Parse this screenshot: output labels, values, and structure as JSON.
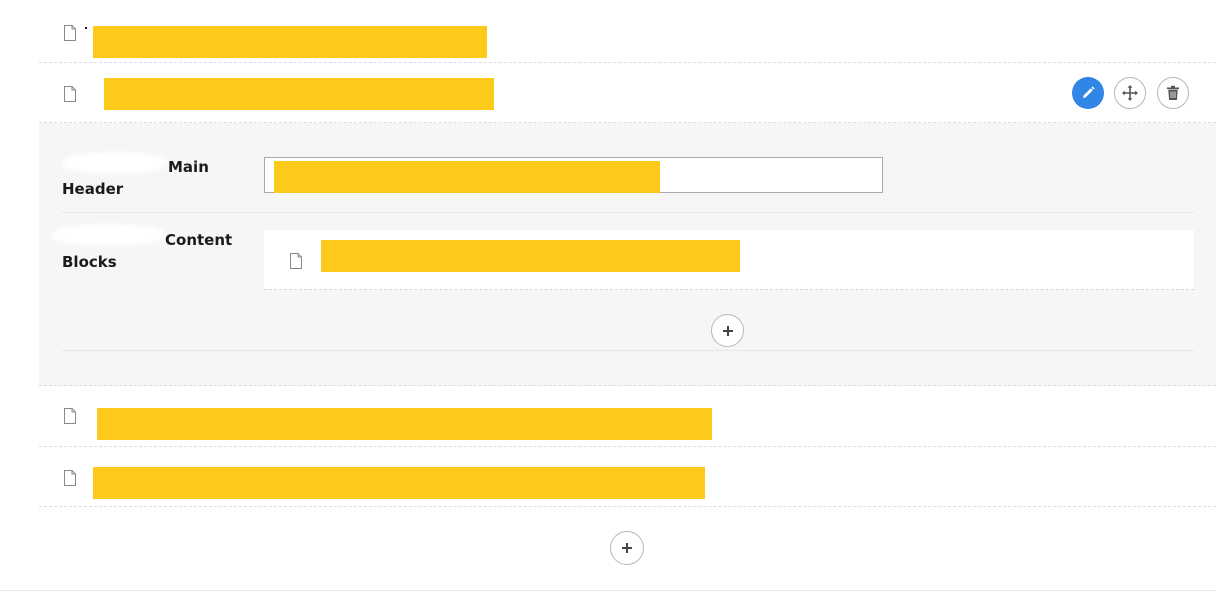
{
  "rows": [
    {
      "icon": "document-icon",
      "label": ""
    },
    {
      "icon": "document-icon",
      "label": ""
    },
    {
      "icon": "document-icon",
      "label": ""
    },
    {
      "icon": "document-icon",
      "label": ""
    }
  ],
  "row_actions": [
    {
      "name": "edit",
      "icon": "pencil-icon"
    },
    {
      "name": "move",
      "icon": "move-arrows-icon"
    },
    {
      "name": "delete",
      "icon": "trash-icon"
    }
  ],
  "editor": {
    "main_header": {
      "label_top": "Main",
      "label_bottom": "Header",
      "value": ""
    },
    "content_blocks": {
      "label_top": "Content",
      "label_bottom": "Blocks",
      "items": [
        {
          "icon": "document-icon",
          "label": ""
        }
      ],
      "add_icon": "plus-icon"
    }
  },
  "add_row_icon": "plus-icon",
  "colors": {
    "redaction": "#fdca1c",
    "primary": "#2f86e6",
    "panel_background": "#f6f6f6"
  }
}
